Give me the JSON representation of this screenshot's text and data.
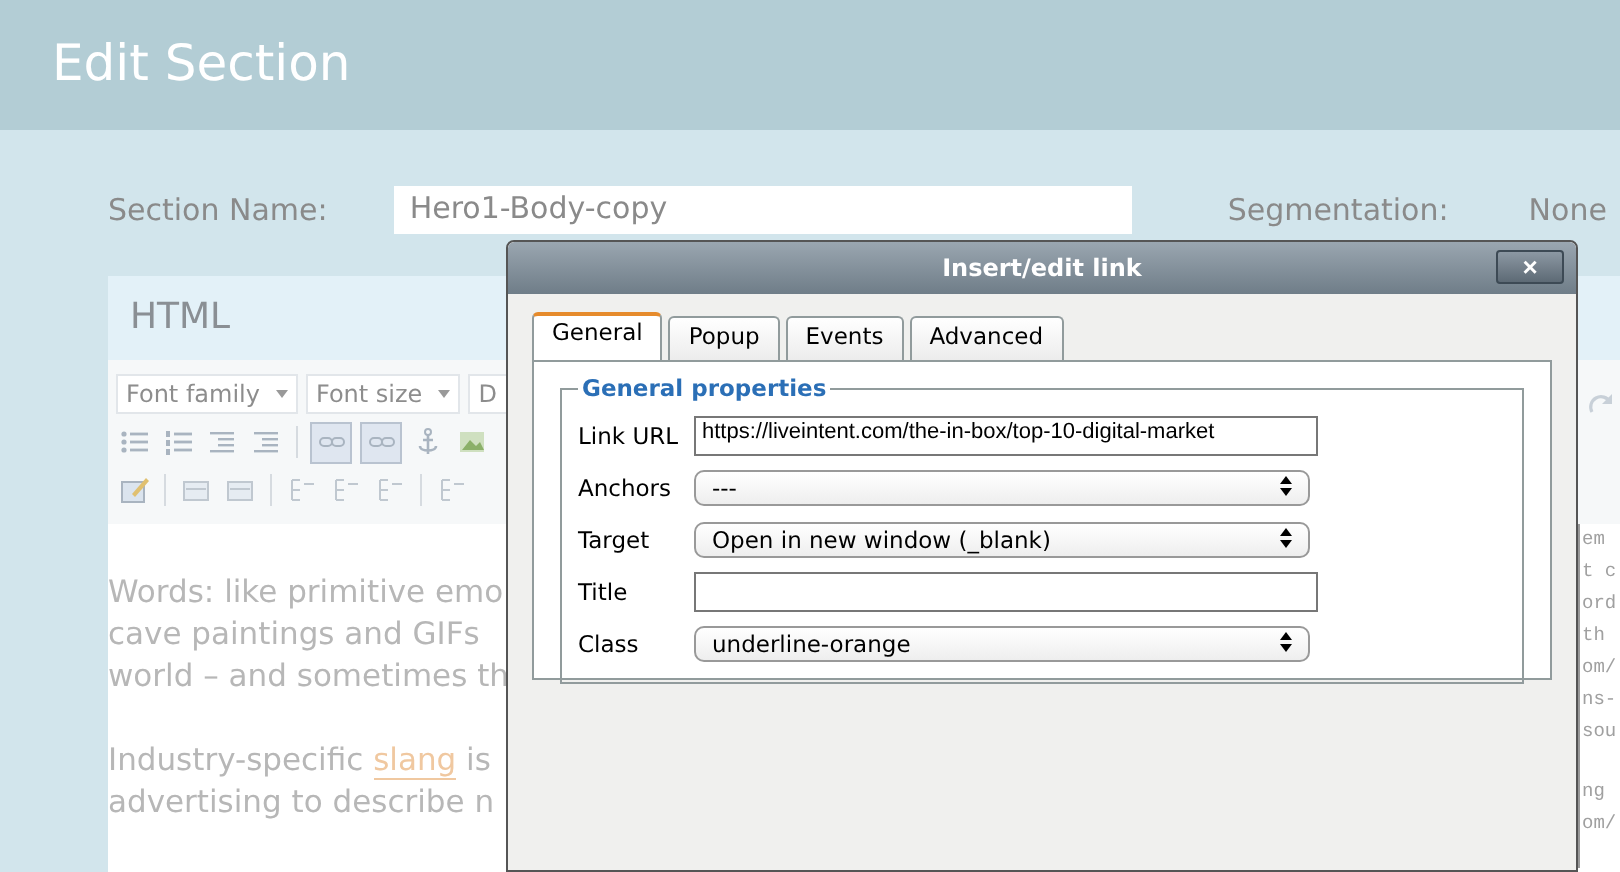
{
  "header": {
    "title": "Edit Section"
  },
  "section_row": {
    "name_label": "Section Name:",
    "name_value": "Hero1-Body-copy",
    "segmentation_label": "Segmentation:",
    "segmentation_value": "None"
  },
  "editor": {
    "title": "HTML",
    "dropdowns": [
      {
        "label": "Font family"
      },
      {
        "label": "Font size"
      },
      {
        "label": "D"
      }
    ],
    "content": [
      {
        "lines": [
          "Words: like primitive emo",
          "cave paintings and GIFs",
          "world – and sometimes th"
        ]
      },
      {
        "lines": [
          "Industry-specific *slang* is",
          "advertising to describe n"
        ]
      }
    ],
    "code_blocks": [
      [
        "em",
        "t c",
        "ord",
        "th",
        "om/",
        "ns-",
        "sou"
      ],
      [
        "ng",
        "om/"
      ]
    ]
  },
  "dialog": {
    "title": "Insert/edit link",
    "close": "×",
    "tabs": [
      {
        "label": "General",
        "selected": true
      },
      {
        "label": "Popup",
        "selected": false
      },
      {
        "label": "Events",
        "selected": false
      },
      {
        "label": "Advanced",
        "selected": false
      }
    ],
    "group_title": "General properties",
    "fields": [
      {
        "label": "Link URL",
        "kind": "text",
        "value": "https://liveintent.com/the-in-box/top-10-digital-market"
      },
      {
        "label": "Anchors",
        "kind": "select",
        "value": "---"
      },
      {
        "label": "Target",
        "kind": "select",
        "value": "Open in new window (_blank)"
      },
      {
        "label": "Title",
        "kind": "text"
      },
      {
        "label": "Class",
        "kind": "select",
        "value": "underline-orange"
      }
    ]
  }
}
